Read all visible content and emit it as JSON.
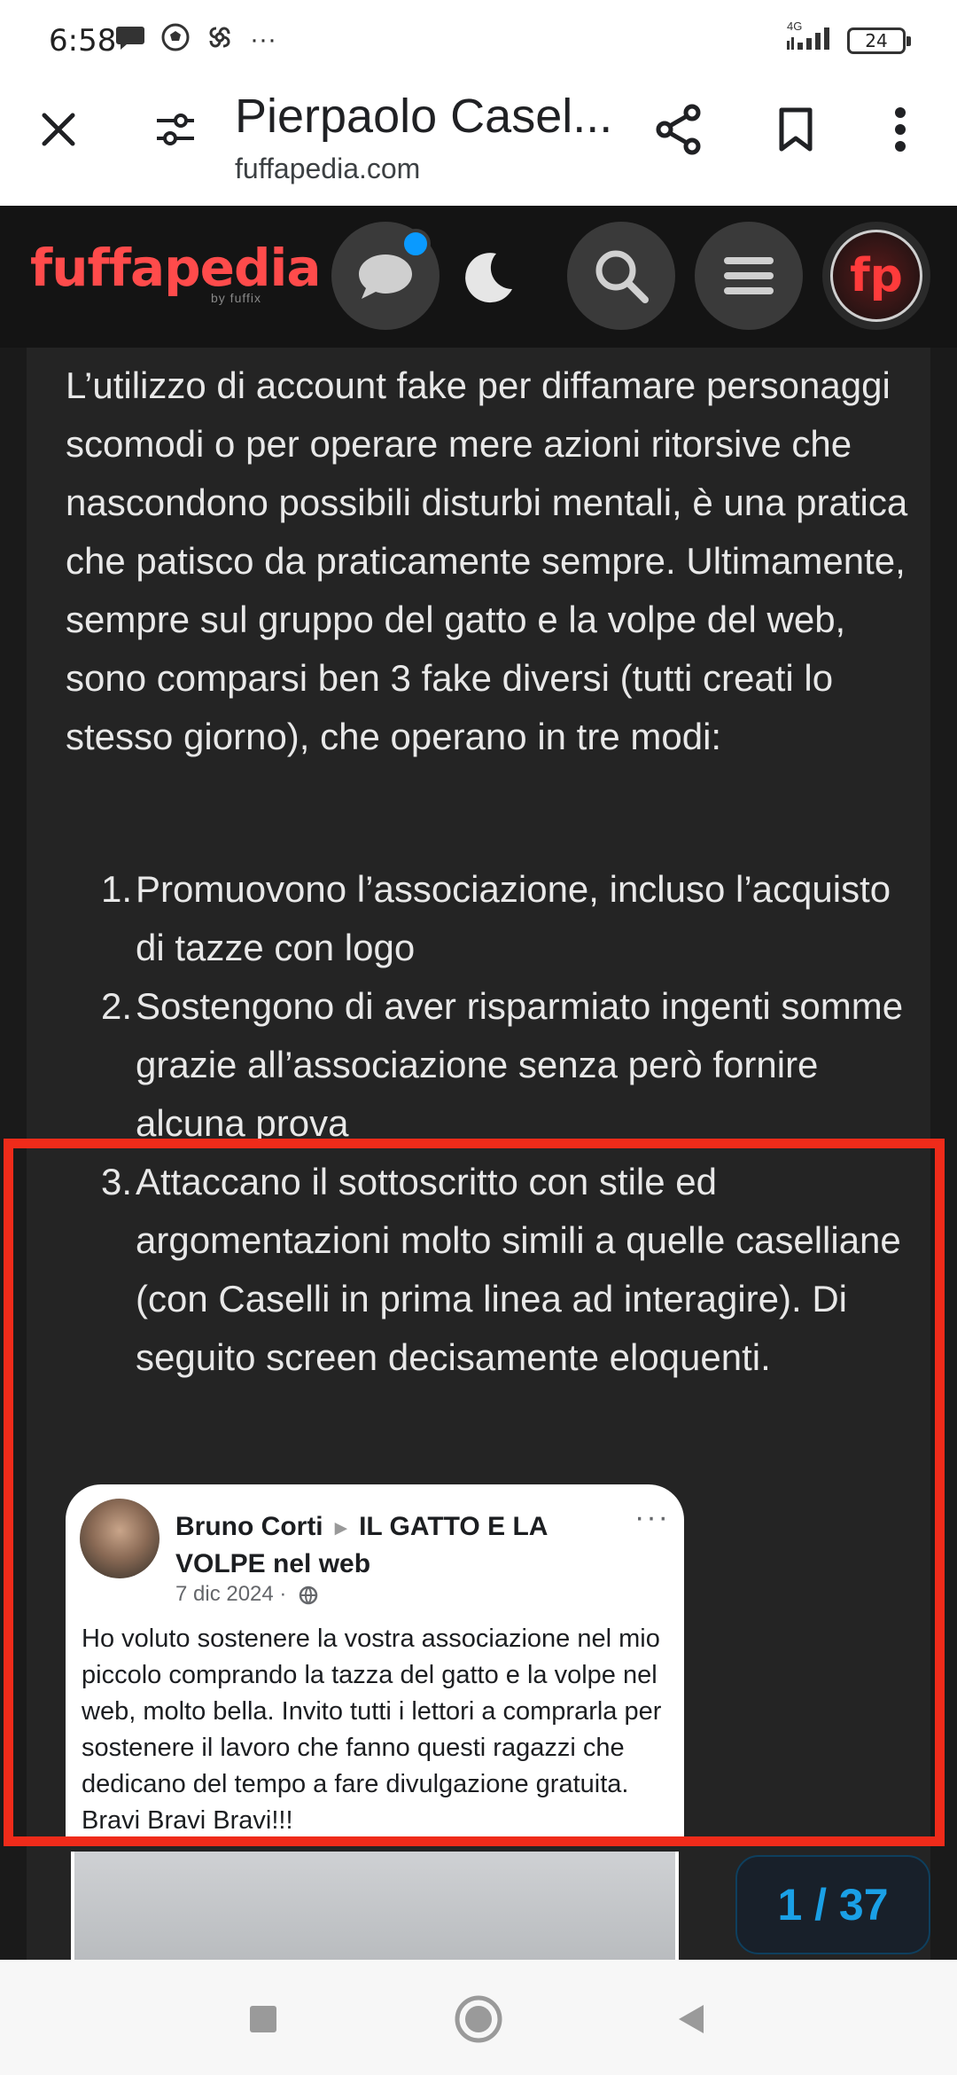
{
  "status_bar": {
    "time": "6:58",
    "overflow": "···",
    "network": "4G",
    "battery": "24"
  },
  "browser": {
    "title": "Pierpaolo Casel...",
    "domain": "fuffapedia.com"
  },
  "site": {
    "logo": "fuffapedia",
    "logo_sub": "by fuffix",
    "avatar_initials": "fp"
  },
  "article": {
    "paragraph": "L’utilizzo di account fake per diffamare personaggi scomodi o per operare mere azioni ritorsive che nascondono possibili disturbi mentali, è una pratica che patisco da praticamente sempre. Ultimamente, sempre sul gruppo del gatto e la volpe del web, sono comparsi ben 3 fake diversi (tutti creati lo stesso giorno), che operano in tre modi:",
    "list": [
      {
        "num": "1.",
        "text": "Promuovono l’associazione, incluso l’acquisto di tazze con logo"
      },
      {
        "num": "2.",
        "text": "Sostengono di aver risparmiato ingenti somme grazie all’associazione senza però fornire alcuna prova"
      },
      {
        "num": "3.",
        "text": "Attaccano il sottoscritto con stile ed argomentazioni molto simili a quelle caselliane (con Caselli in prima linea ad interagire). Di seguito screen decisamente eloquenti."
      }
    ]
  },
  "fb_post": {
    "author": "Bruno Corti",
    "arrow": "►",
    "group": "IL GATTO E LA VOLPE nel web",
    "date": "7 dic 2024 ·",
    "more": "···",
    "text": "Ho voluto sostenere la vostra associazione nel mio piccolo comprando la tazza del gatto e la volpe nel web, molto bella. Invito tutti i lettori a comprarla per sostenere il lavoro che fanno questi ragazzi che dedicano del tempo a fare divulgazione gratuita. Bravi Bravi Bravi!!!"
  },
  "gallery": {
    "counter": "1 / 37"
  },
  "colors": {
    "brand": "#ff4b4b",
    "highlight": "#ef2b1a",
    "accent": "#1aa0e6",
    "header_bg": "#141414"
  }
}
